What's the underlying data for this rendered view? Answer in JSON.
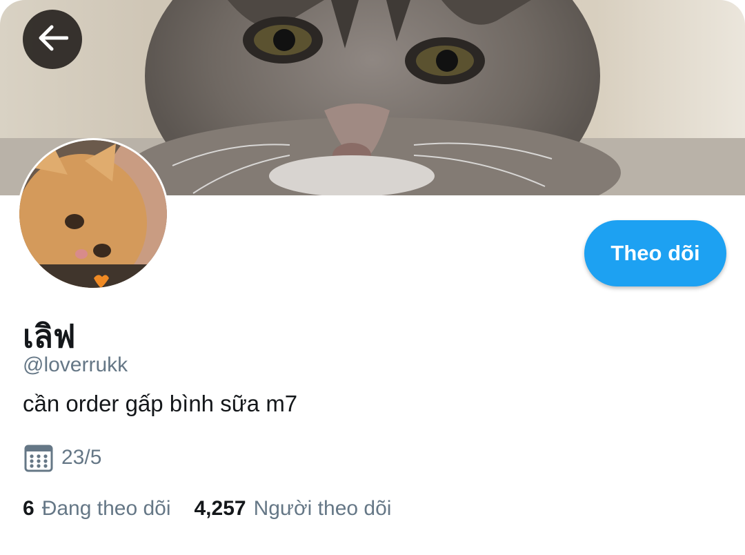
{
  "profile": {
    "display_name": "เลิฟ",
    "handle": "@loverrukk",
    "bio": "cần order gấp bình sữa m7",
    "joined": "23/5"
  },
  "header": {
    "back_icon": "arrow-left-icon"
  },
  "actions": {
    "follow_label": "Theo dõi"
  },
  "stats": {
    "following_count": "6",
    "following_label": "Đang theo dõi",
    "followers_count": "4,257",
    "followers_label": "Người theo dõi"
  },
  "icons": {
    "calendar": "calendar-icon"
  },
  "colors": {
    "accent": "#1da1f2",
    "secondary_text": "#657786",
    "primary_text": "#14171a"
  }
}
